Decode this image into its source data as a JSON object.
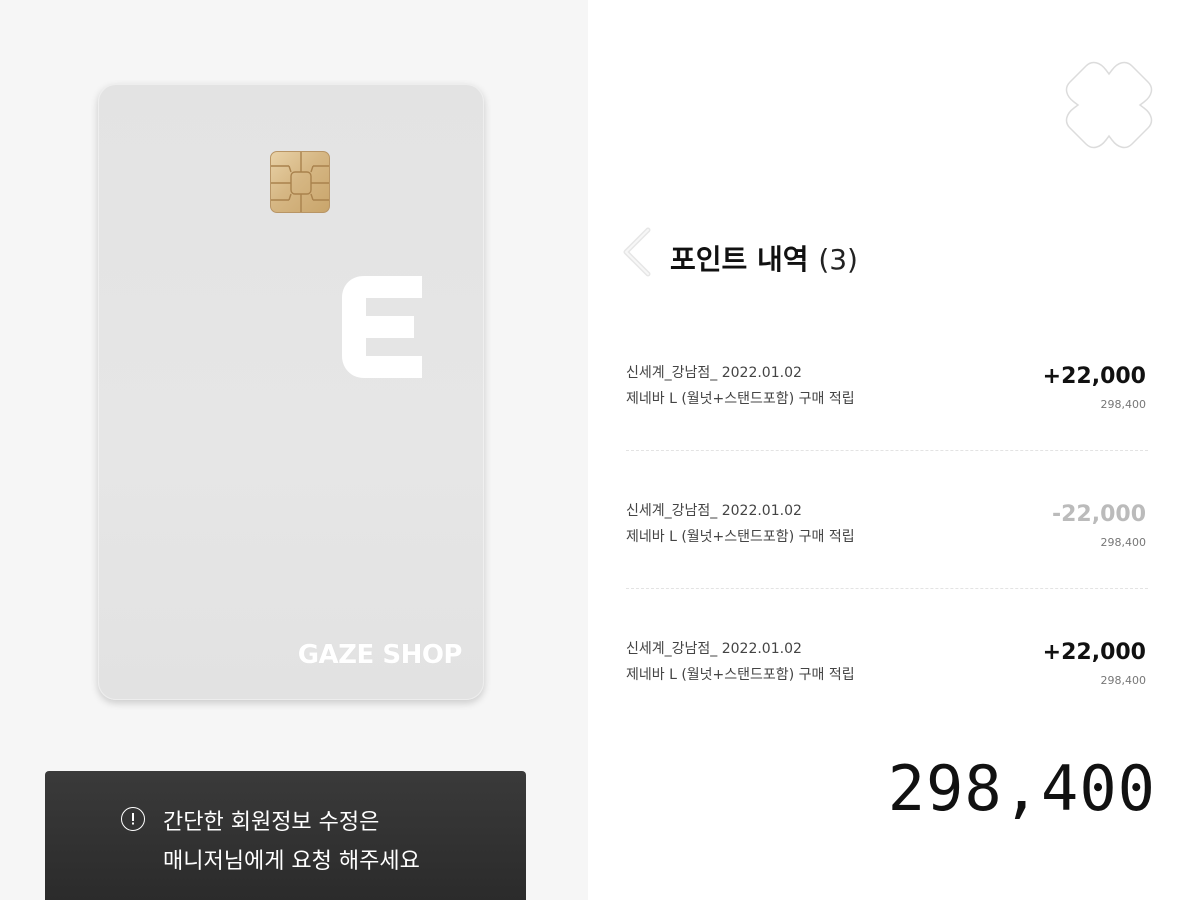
{
  "card": {
    "brand": "GAZE SHOP",
    "logo_letter": "E"
  },
  "notice": {
    "icon": "!",
    "line1": "간단한 회원정보 수정은",
    "line2": "매니저님에게 요청 해주세요"
  },
  "header": {
    "title": "포인트 내역",
    "count": "(3)"
  },
  "history": [
    {
      "line1": "신세계_강남점_ 2022.01.02",
      "line2": "제네바 L (월넛+스탠드포함) 구매 적립",
      "amount": "+22,000",
      "balance": "298,400",
      "type": "earn"
    },
    {
      "line1": "신세계_강남점_ 2022.01.02",
      "line2": "제네바 L (월넛+스탠드포함) 구매 적립",
      "amount": "-22,000",
      "balance": "298,400",
      "type": "use"
    },
    {
      "line1": "신세계_강남점_ 2022.01.02",
      "line2": "제네바 L (월넛+스탠드포함) 구매 적립",
      "amount": "+22,000",
      "balance": "298,400",
      "type": "earn"
    }
  ],
  "total": "298,400",
  "icons": {
    "close": "close-icon",
    "back": "chevron-left-icon",
    "info": "info-icon",
    "chip": "card-chip-icon"
  },
  "colors": {
    "negative_amount": "#bbbbbb",
    "notice_bg": "#2e2e2e"
  }
}
